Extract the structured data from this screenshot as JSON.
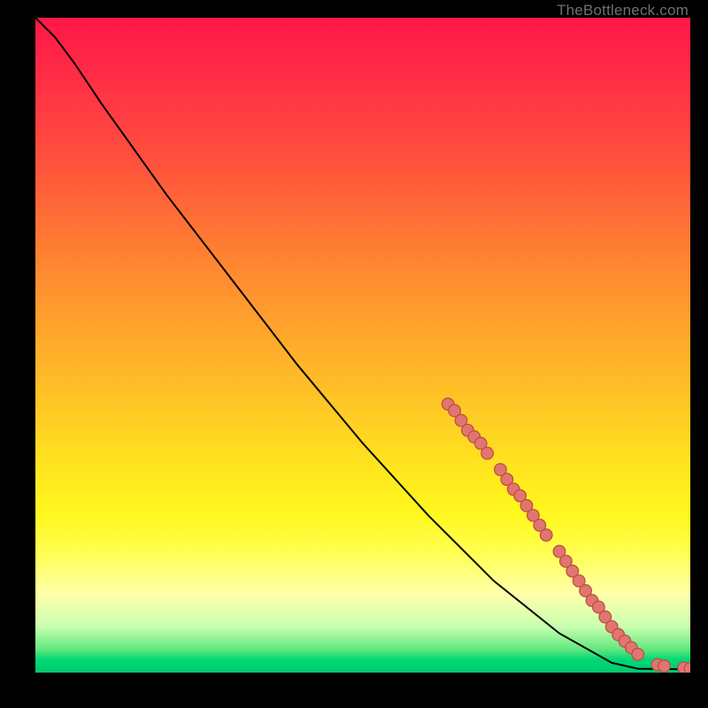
{
  "attribution": "TheBottleneck.com",
  "colors": {
    "marker_fill": "#e0766f",
    "marker_stroke": "#bf4e46",
    "curve": "#000000"
  },
  "chart_data": {
    "type": "line",
    "title": "",
    "xlabel": "",
    "ylabel": "",
    "xlim": [
      0,
      100
    ],
    "ylim": [
      0,
      100
    ],
    "grid": false,
    "data_note": "Curve estimated from pixel positions; axes have no tick labels so values are normalized 0–100.",
    "curve": [
      {
        "x": 0,
        "y": 100
      },
      {
        "x": 3,
        "y": 97
      },
      {
        "x": 6,
        "y": 93
      },
      {
        "x": 10,
        "y": 87
      },
      {
        "x": 20,
        "y": 73
      },
      {
        "x": 30,
        "y": 60
      },
      {
        "x": 40,
        "y": 47
      },
      {
        "x": 50,
        "y": 35
      },
      {
        "x": 60,
        "y": 24
      },
      {
        "x": 70,
        "y": 14
      },
      {
        "x": 80,
        "y": 6
      },
      {
        "x": 88,
        "y": 1.5
      },
      {
        "x": 92,
        "y": 0.6
      },
      {
        "x": 100,
        "y": 0.5
      }
    ],
    "markers": [
      {
        "x": 63,
        "y": 41
      },
      {
        "x": 64,
        "y": 40
      },
      {
        "x": 65,
        "y": 38.5
      },
      {
        "x": 66,
        "y": 37
      },
      {
        "x": 67,
        "y": 36
      },
      {
        "x": 68,
        "y": 35
      },
      {
        "x": 69,
        "y": 33.5
      },
      {
        "x": 71,
        "y": 31
      },
      {
        "x": 72,
        "y": 29.5
      },
      {
        "x": 73,
        "y": 28
      },
      {
        "x": 74,
        "y": 27
      },
      {
        "x": 75,
        "y": 25.5
      },
      {
        "x": 76,
        "y": 24
      },
      {
        "x": 77,
        "y": 22.5
      },
      {
        "x": 78,
        "y": 21
      },
      {
        "x": 80,
        "y": 18.5
      },
      {
        "x": 81,
        "y": 17
      },
      {
        "x": 82,
        "y": 15.5
      },
      {
        "x": 83,
        "y": 14
      },
      {
        "x": 84,
        "y": 12.5
      },
      {
        "x": 85,
        "y": 11
      },
      {
        "x": 86,
        "y": 10
      },
      {
        "x": 87,
        "y": 8.5
      },
      {
        "x": 88,
        "y": 7
      },
      {
        "x": 89,
        "y": 5.8
      },
      {
        "x": 90,
        "y": 4.8
      },
      {
        "x": 91,
        "y": 3.8
      },
      {
        "x": 92,
        "y": 2.8
      },
      {
        "x": 95,
        "y": 1.2
      },
      {
        "x": 96,
        "y": 1.0
      },
      {
        "x": 99,
        "y": 0.7
      },
      {
        "x": 100,
        "y": 0.6
      }
    ]
  }
}
